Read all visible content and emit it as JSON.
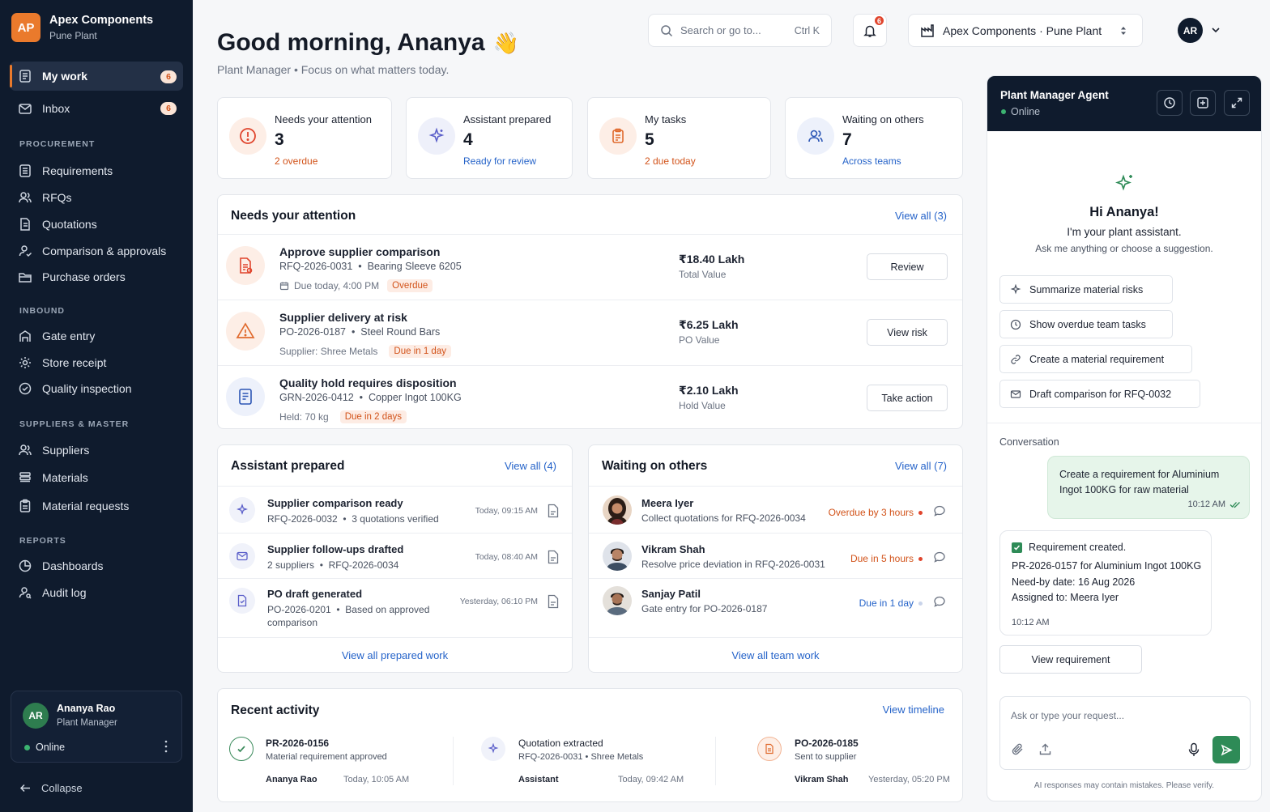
{
  "sidebar": {
    "brand": {
      "initials": "AP",
      "name": "Apex Components",
      "location": "Pune Plant"
    },
    "main_items": [
      {
        "label": "My work",
        "badge": "6",
        "icon": "document-icon"
      },
      {
        "label": "Inbox",
        "badge": "6",
        "icon": "mail-icon"
      }
    ],
    "sections": [
      {
        "title": "PROCUREMENT",
        "items": [
          {
            "label": "Requirements",
            "icon": "list-icon"
          },
          {
            "label": "RFQs",
            "icon": "people-icon"
          },
          {
            "label": "Quotations",
            "icon": "document-icon"
          },
          {
            "label": "Comparison & approvals",
            "icon": "user-check-icon"
          },
          {
            "label": "Purchase orders",
            "icon": "folder-icon"
          }
        ]
      },
      {
        "title": "INBOUND",
        "items": [
          {
            "label": "Gate entry",
            "icon": "gate-icon"
          },
          {
            "label": "Store receipt",
            "icon": "gear-icon"
          },
          {
            "label": "Quality inspection",
            "icon": "badge-check-icon"
          }
        ]
      },
      {
        "title": "SUPPLIERS & MASTER",
        "items": [
          {
            "label": "Suppliers",
            "icon": "people-icon"
          },
          {
            "label": "Materials",
            "icon": "stack-icon"
          },
          {
            "label": "Material requests",
            "icon": "clipboard-icon"
          }
        ]
      },
      {
        "title": "REPORTS",
        "items": [
          {
            "label": "Dashboards",
            "icon": "chart-icon"
          },
          {
            "label": "Audit log",
            "icon": "user-search-icon"
          }
        ]
      }
    ],
    "user": {
      "initials": "AR",
      "name": "Ananya Rao",
      "role": "Plant Manager",
      "status": "Online"
    },
    "collapse_label": "Collapse"
  },
  "header": {
    "greeting": "Good morning, Ananya",
    "wave": "👋",
    "subtitle": "Plant Manager • Focus on what matters today.",
    "search_placeholder": "Search or go to...",
    "search_shortcut": "Ctrl K",
    "notification_count": "6",
    "org_selector": "Apex Components · Pune Plant",
    "user_initials": "AR"
  },
  "stats": [
    {
      "title": "Needs your attention",
      "value": "3",
      "sub": "2 overdue",
      "color": "#d2531a"
    },
    {
      "title": "Assistant prepared",
      "value": "4",
      "sub": "Ready for review",
      "color": "#2563c9"
    },
    {
      "title": "My tasks",
      "value": "5",
      "sub": "2 due today",
      "color": "#d2531a"
    },
    {
      "title": "Waiting on others",
      "value": "7",
      "sub": "Across teams",
      "color": "#2563c9"
    }
  ],
  "attention": {
    "title": "Needs your attention",
    "view_all": "View all (3)",
    "rows": [
      {
        "title": "Approve supplier comparison",
        "ref": "RFQ-2026-0031",
        "detail": "Bearing Sleeve 6205",
        "meta": "Due today, 4:00 PM",
        "pill": "Overdue",
        "value": "₹18.40 Lakh",
        "value_label": "Total Value",
        "action": "Review"
      },
      {
        "title": "Supplier delivery at risk",
        "ref": "PO-2026-0187",
        "detail": "Steel Round Bars",
        "meta": "Supplier: Shree Metals",
        "pill": "Due in 1 day",
        "value": "₹6.25 Lakh",
        "value_label": "PO Value",
        "action": "View risk"
      },
      {
        "title": "Quality hold requires disposition",
        "ref": "GRN-2026-0412",
        "detail": "Copper Ingot 100KG",
        "meta": "Held: 70 kg",
        "pill": "Due in 2 days",
        "value": "₹2.10 Lakh",
        "value_label": "Hold Value",
        "action": "Take action"
      }
    ]
  },
  "prepared": {
    "title": "Assistant prepared",
    "view_all": "View all (4)",
    "rows": [
      {
        "title": "Supplier comparison ready",
        "sub1": "RFQ-2026-0032",
        "sub2": "3 quotations verified",
        "time": "Today, 09:15 AM"
      },
      {
        "title": "Supplier follow-ups drafted",
        "sub1": "2 suppliers",
        "sub2": "RFQ-2026-0034",
        "time": "Today, 08:40 AM"
      },
      {
        "title": "PO draft generated",
        "sub1": "PO-2026-0201",
        "sub2": "Based on approved",
        "sub3": "comparison",
        "time": "Yesterday, 06:10 PM"
      }
    ],
    "footer": "View all prepared work"
  },
  "waiting": {
    "title": "Waiting on others",
    "view_all": "View all (7)",
    "rows": [
      {
        "name": "Meera Iyer",
        "task": "Collect quotations for RFQ-2026-0034",
        "status": "Overdue by 3 hours",
        "color": "#d2531a"
      },
      {
        "name": "Vikram Shah",
        "task": "Resolve price deviation in RFQ-2026-0031",
        "status": "Due in 5 hours",
        "color": "#d2531a"
      },
      {
        "name": "Sanjay Patil",
        "task": "Gate entry for PO-2026-0187",
        "status": "Due in 1 day",
        "color": "#2563c9"
      }
    ],
    "footer": "View all team work"
  },
  "activity": {
    "title": "Recent activity",
    "link": "View timeline",
    "items": [
      {
        "title": "PR-2026-0156",
        "sub": "Material requirement approved",
        "who": "Ananya Rao",
        "when": "Today, 10:05 AM"
      },
      {
        "title": "Quotation extracted",
        "sub": "RFQ-2026-0031 • Shree Metals",
        "who": "Assistant",
        "when": "Today, 09:42 AM"
      },
      {
        "title": "PO-2026-0185",
        "sub": "Sent to supplier",
        "who": "Vikram Shah",
        "when": "Yesterday, 05:20 PM"
      }
    ]
  },
  "agent": {
    "title": "Plant Manager Agent",
    "status": "Online",
    "hello": "Hi Ananya!",
    "intro": "I'm your plant assistant.",
    "hint": "Ask me anything or choose a suggestion.",
    "suggestions": [
      {
        "label": "Summarize material risks",
        "icon": "sparkle-icon"
      },
      {
        "label": "Show overdue team tasks",
        "icon": "clock-icon"
      },
      {
        "label": "Create a material requirement",
        "icon": "link-icon"
      },
      {
        "label": "Draft comparison for RFQ-0032",
        "icon": "mail-icon"
      }
    ],
    "conversation_label": "Conversation",
    "user_msg_1": "Create a requirement for Aluminium",
    "user_msg_2": "Ingot 100KG for raw material",
    "user_msg_time": "10:12 AM",
    "reply": {
      "heading": "Requirement created.",
      "line1": "PR-2026-0157 for Aluminium Ingot 100KG",
      "need_label": "Need-by date:",
      "need_value": "16 Aug 2026",
      "assigned_label": "Assigned to:",
      "assigned_value": "Meera Iyer",
      "time": "10:12 AM"
    },
    "view_button": "View requirement",
    "input_placeholder": "Ask or type your request...",
    "disclaimer": "AI responses may contain mistakes. Please verify."
  },
  "colors": {
    "sidebar_bg": "#0f1b2d",
    "accent": "#ea7a2c",
    "link": "#2563c9",
    "danger": "#d2531a",
    "success": "#2e8b57"
  }
}
